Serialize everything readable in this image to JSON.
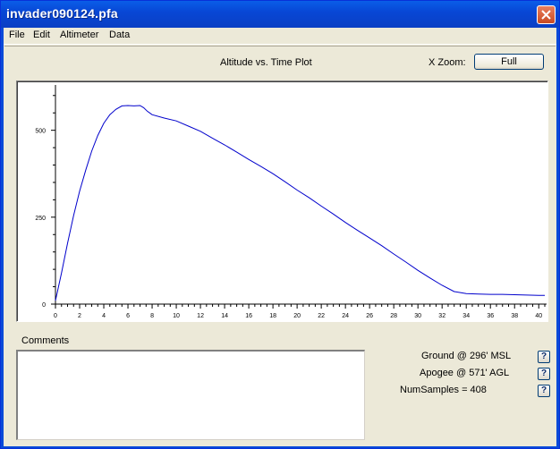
{
  "window": {
    "title": "invader090124.pfa"
  },
  "menu": {
    "items": [
      "File",
      "Edit",
      "Altimeter",
      "Data"
    ]
  },
  "plot": {
    "title": "Altitude vs. Time Plot",
    "xzoom_label": "X Zoom:",
    "full_button": "Full"
  },
  "comments": {
    "label": "Comments",
    "value": ""
  },
  "stats": {
    "ground": "Ground @ 296' MSL",
    "apogee": "Apogee @ 571' AGL",
    "samples": "NumSamples = 408",
    "help_label": "?"
  },
  "colors": {
    "trace": "#0000cc",
    "titlebar": "#0a4ad8"
  },
  "chart_data": {
    "type": "line",
    "title": "Altitude vs. Time Plot",
    "xlim": [
      0,
      40.5
    ],
    "ylim": [
      0,
      620
    ],
    "xticks": [
      0,
      2,
      4,
      6,
      8,
      10,
      12,
      14,
      16,
      18,
      20,
      22,
      24,
      26,
      28,
      30,
      32,
      34,
      36,
      38,
      40
    ],
    "yticks": [
      0,
      250,
      500
    ],
    "grid": false,
    "series": [
      {
        "x": [
          0,
          0.5,
          1,
          1.5,
          2,
          2.5,
          3,
          3.5,
          4,
          4.5,
          5,
          5.5,
          6,
          6.5,
          7,
          7.3,
          7.6,
          8,
          9,
          10,
          11,
          12,
          13,
          14,
          15,
          16,
          17,
          18,
          19,
          20,
          21,
          22,
          23,
          24,
          25,
          26,
          27,
          28,
          29,
          30,
          31,
          32,
          33,
          34,
          35,
          36,
          37,
          38,
          39,
          40,
          40.5
        ],
        "y": [
          10,
          90,
          175,
          255,
          325,
          385,
          440,
          485,
          520,
          545,
          560,
          570,
          571,
          570,
          571,
          565,
          555,
          545,
          535,
          527,
          512,
          497,
          477,
          458,
          437,
          416,
          396,
          375,
          352,
          328,
          306,
          282,
          259,
          235,
          212,
          190,
          168,
          144,
          121,
          97,
          75,
          54,
          36,
          30,
          29,
          28,
          28,
          27,
          26,
          25,
          25
        ]
      }
    ]
  }
}
